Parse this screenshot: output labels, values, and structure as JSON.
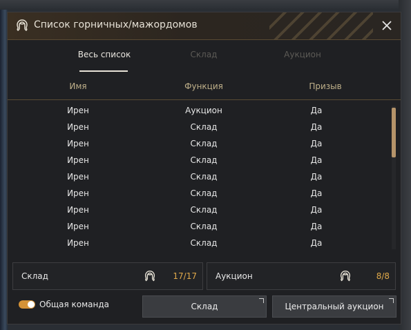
{
  "window": {
    "title": "Список горничных/мажордомов"
  },
  "tabs": [
    {
      "label": "Весь список",
      "active": true
    },
    {
      "label": "Склад",
      "active": false
    },
    {
      "label": "Аукцион",
      "active": false
    }
  ],
  "table": {
    "headers": [
      "Имя",
      "Функция",
      "Призыв"
    ],
    "rows": [
      [
        "Ирен",
        "Аукцион",
        "Да"
      ],
      [
        "Ирен",
        "Склад",
        "Да"
      ],
      [
        "Ирен",
        "Склад",
        "Да"
      ],
      [
        "Ирен",
        "Склад",
        "Да"
      ],
      [
        "Ирен",
        "Склад",
        "Да"
      ],
      [
        "Ирен",
        "Склад",
        "Да"
      ],
      [
        "Ирен",
        "Склад",
        "Да"
      ],
      [
        "Ирен",
        "Склад",
        "Да"
      ],
      [
        "Ирен",
        "Склад",
        "Да"
      ]
    ]
  },
  "summary": {
    "storage": {
      "label": "Склад",
      "count": "17/17",
      "icon": "maid-icon"
    },
    "auction": {
      "label": "Аукцион",
      "count": "8/8",
      "icon": "maid-icon"
    }
  },
  "footer": {
    "toggle_label": "Общая команда",
    "toggle_on": true,
    "storage_button": "Склад",
    "auction_button": "Центральный аукцион"
  },
  "colors": {
    "accent": "#d59236",
    "count": "#e0a94a",
    "header": "#bfb08a"
  }
}
